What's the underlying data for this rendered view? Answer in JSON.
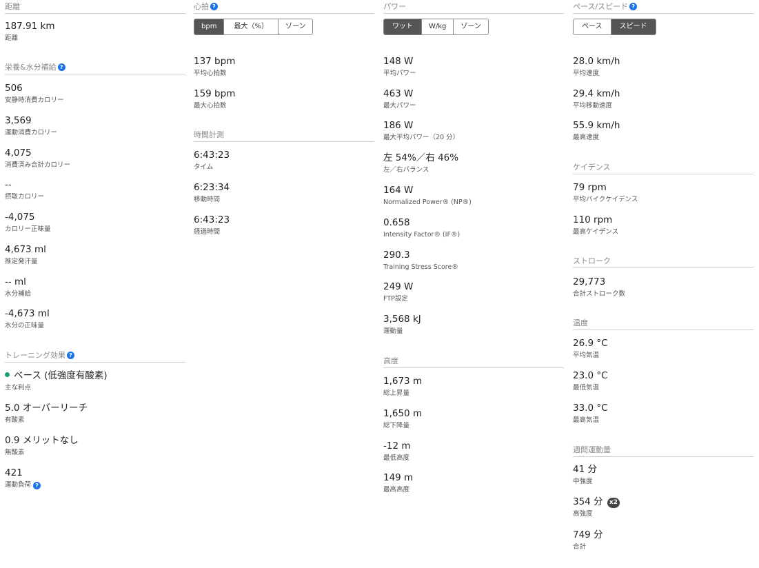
{
  "col1": {
    "distance": {
      "title": "距離",
      "stats": [
        {
          "value": "187.91 km",
          "label": "距離"
        }
      ]
    },
    "nutrition": {
      "title": "栄養&水分補給",
      "stats": [
        {
          "value": "506",
          "label": "安静時消費カロリー"
        },
        {
          "value": "3,569",
          "label": "運動消費カロリー"
        },
        {
          "value": "4,075",
          "label": "消費済み合計カロリー"
        },
        {
          "value": "--",
          "label": "摂取カロリー"
        },
        {
          "value": "-4,075",
          "label": "カロリー正味量"
        },
        {
          "value": "4,673 ml",
          "label": "推定発汗量"
        },
        {
          "value": "-- ml",
          "label": "水分補給"
        },
        {
          "value": "-4,673 ml",
          "label": "水分の正味量"
        }
      ]
    },
    "training": {
      "title": "トレーニング効果",
      "stats": [
        {
          "value": "ベース (低強度有酸素)",
          "label": "主な利点"
        },
        {
          "value": "5.0 オーバーリーチ",
          "label": "有酸素"
        },
        {
          "value": "0.9 メリットなし",
          "label": "無酸素"
        },
        {
          "value": "421",
          "label": "運動負荷"
        }
      ]
    }
  },
  "col2": {
    "hr": {
      "title": "心拍",
      "buttons": [
        "bpm",
        "最大（%）",
        "ゾーン"
      ],
      "stats": [
        {
          "value": "137 bpm",
          "label": "平均心拍数"
        },
        {
          "value": "159 bpm",
          "label": "最大心拍数"
        }
      ]
    },
    "timing": {
      "title": "時間計測",
      "stats": [
        {
          "value": "6:43:23",
          "label": "タイム"
        },
        {
          "value": "6:23:34",
          "label": "移動時間"
        },
        {
          "value": "6:43:23",
          "label": "経過時間"
        }
      ]
    }
  },
  "col3": {
    "power": {
      "title": "パワー",
      "buttons": [
        "ワット",
        "W/kg",
        "ゾーン"
      ],
      "stats": [
        {
          "value": "148 W",
          "label": "平均パワー"
        },
        {
          "value": "463 W",
          "label": "最大パワー"
        },
        {
          "value": "186 W",
          "label": "最大平均パワー（20 分）"
        },
        {
          "value": "左 54%／右 46%",
          "label": "左／右バランス"
        },
        {
          "value": "164 W",
          "label": "Normalized Power® (NP®)"
        },
        {
          "value": "0.658",
          "label": "Intensity Factor® (IF®)"
        },
        {
          "value": "290.3",
          "label": "Training Stress Score®"
        },
        {
          "value": "249 W",
          "label": "FTP設定"
        },
        {
          "value": "3,568 kJ",
          "label": "運動量"
        }
      ]
    },
    "elevation": {
      "title": "高度",
      "stats": [
        {
          "value": "1,673 m",
          "label": "総上昇量"
        },
        {
          "value": "1,650 m",
          "label": "総下降量"
        },
        {
          "value": "-12 m",
          "label": "最低高度"
        },
        {
          "value": "149 m",
          "label": "最高高度"
        }
      ]
    }
  },
  "col4": {
    "pace": {
      "title": "ペース/スピード",
      "buttons": [
        "ペース",
        "スピード"
      ],
      "stats": [
        {
          "value": "28.0 km/h",
          "label": "平均速度"
        },
        {
          "value": "29.4 km/h",
          "label": "平均移動速度"
        },
        {
          "value": "55.9 km/h",
          "label": "最高速度"
        }
      ]
    },
    "cadence": {
      "title": "ケイデンス",
      "stats": [
        {
          "value": "79 rpm",
          "label": "平均バイクケイデンス"
        },
        {
          "value": "110 rpm",
          "label": "最高ケイデンス"
        }
      ]
    },
    "strokes": {
      "title": "ストローク",
      "stats": [
        {
          "value": "29,773",
          "label": "合計ストローク数"
        }
      ]
    },
    "temp": {
      "title": "温度",
      "stats": [
        {
          "value": "26.9 °C",
          "label": "平均気温"
        },
        {
          "value": "23.0 °C",
          "label": "最低気温"
        },
        {
          "value": "33.0 °C",
          "label": "最高気温"
        }
      ]
    },
    "weekly": {
      "title": "週間運動量",
      "badge": "x2",
      "stats": [
        {
          "value": "41 分",
          "label": "中強度"
        },
        {
          "value": "354 分",
          "label": "高強度"
        },
        {
          "value": "749 分",
          "label": "合計"
        }
      ]
    }
  }
}
